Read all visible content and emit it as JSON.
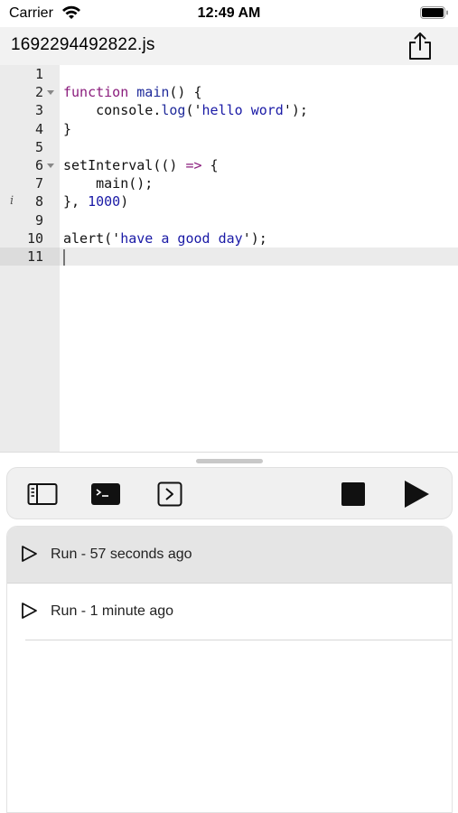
{
  "status_bar": {
    "carrier": "Carrier",
    "time": "12:49 AM"
  },
  "title_bar": {
    "file_name": "1692294492822.js",
    "share_icon": "share-icon"
  },
  "editor": {
    "lines": [
      {
        "num": "1",
        "code": ""
      },
      {
        "num": "2",
        "code": "function main() {",
        "fold": true
      },
      {
        "num": "3",
        "code": "    console.log('hello word');"
      },
      {
        "num": "4",
        "code": "}"
      },
      {
        "num": "5",
        "code": ""
      },
      {
        "num": "6",
        "code": "setInterval(() => {",
        "fold": true
      },
      {
        "num": "7",
        "code": "    main();"
      },
      {
        "num": "8",
        "code": "}, 1000)",
        "info": "i"
      },
      {
        "num": "9",
        "code": ""
      },
      {
        "num": "10",
        "code": "alert('have a good day');"
      },
      {
        "num": "11",
        "code": "",
        "active": true
      }
    ]
  },
  "toolbar": {
    "icons": [
      "sidebar-icon",
      "terminal-icon",
      "console-prompt-icon",
      "stop-icon",
      "play-icon"
    ]
  },
  "runs": {
    "items": [
      {
        "label": "Run - 57 seconds ago",
        "selected": true
      },
      {
        "label": "Run - 1  minute ago",
        "selected": false
      }
    ]
  },
  "colors": {
    "keyword": "#8a1c7c",
    "function_name": "#1f2a9a",
    "string": "#1a1aa6",
    "gutter_bg": "#ebebeb",
    "selected_row": "#e5e5e5"
  }
}
